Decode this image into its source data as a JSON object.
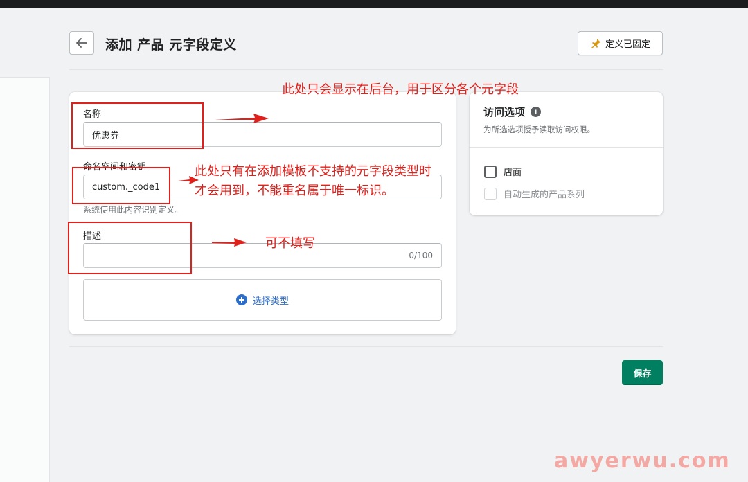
{
  "header": {
    "title": "添加 产品 元字段定义",
    "pin_label": "定义已固定"
  },
  "form": {
    "name": {
      "label": "名称",
      "value": "优惠券"
    },
    "namespace": {
      "label": "命名空间和密钥",
      "value": "custom._code1",
      "help": "系统使用此内容识别定义。"
    },
    "description": {
      "label": "描述",
      "value": "",
      "counter": "0/100"
    },
    "select_type_label": "选择类型"
  },
  "access": {
    "title": "访问选项",
    "info": "i",
    "subtitle": "为所选选项授予读取访问权限。",
    "options": [
      {
        "label": "店面",
        "checked": false,
        "disabled": false
      },
      {
        "label": "自动生成的产品系列",
        "checked": false,
        "disabled": true
      }
    ]
  },
  "save_label": "保存",
  "annotations": {
    "a1": "此处只会显示在后台，用于区分各个元字段",
    "a2_line1": "此处只有在添加模板不支持的元字段类型时",
    "a2_line2": "才会用到，不能重名属于唯一标识。",
    "a3": "可不填写"
  },
  "watermark": "awyerwu.com",
  "colors": {
    "accent": "#008060",
    "annotation": "#e0201b",
    "link": "#2c6ecb"
  },
  "icons": [
    "arrow-left-icon",
    "pin-icon",
    "plus-circle-icon",
    "info-icon"
  ]
}
